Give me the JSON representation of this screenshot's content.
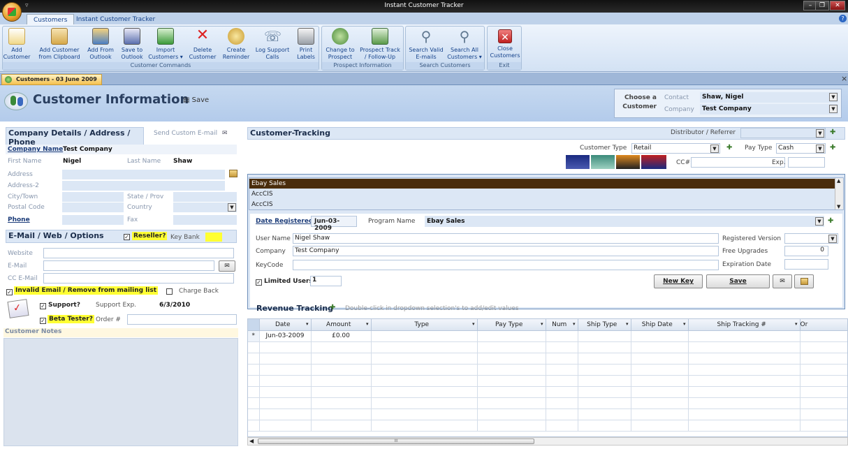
{
  "window": {
    "title": "Instant Customer Tracker",
    "help_glyph": "?"
  },
  "ribbon_tabs": [
    "Customers",
    "Instant Customer Tracker"
  ],
  "ribbon_groups": [
    {
      "label": "Customer Commands",
      "buttons": [
        {
          "line1": "Add",
          "line2": "Customer",
          "icon": "add-customer-icon"
        },
        {
          "line1": "Add Customer",
          "line2": "from Clipboard",
          "icon": "clipboard-icon"
        },
        {
          "line1": "Add From",
          "line2": "Outlook",
          "icon": "outlook-add-icon"
        },
        {
          "line1": "Save to",
          "line2": "Outlook",
          "icon": "outlook-save-icon"
        },
        {
          "line1": "Import",
          "line2": "Customers ▾",
          "icon": "import-icon"
        },
        {
          "line1": "Delete",
          "line2": "Customer",
          "icon": "delete-icon"
        },
        {
          "line1": "Create",
          "line2": "Reminder",
          "icon": "reminder-icon"
        },
        {
          "line1": "Log Support",
          "line2": "Calls",
          "icon": "phone-icon"
        },
        {
          "line1": "Print",
          "line2": "Labels",
          "icon": "printer-icon"
        }
      ]
    },
    {
      "label": "Prospect Information",
      "buttons": [
        {
          "line1": "Change to",
          "line2": "Prospect",
          "icon": "prospect-icon"
        },
        {
          "line1": "Prospect Track",
          "line2": "/ Follow-Up",
          "icon": "followup-icon"
        }
      ]
    },
    {
      "label": "Search Customers",
      "buttons": [
        {
          "line1": "Search Valid",
          "line2": "E-mails",
          "icon": "search-icon"
        },
        {
          "line1": "Search All",
          "line2": "Customers ▾",
          "icon": "search-all-icon"
        }
      ]
    },
    {
      "label": "Exit",
      "buttons": [
        {
          "line1": "Close",
          "line2": "Customers",
          "icon": "close-icon"
        }
      ]
    }
  ],
  "doc_tab": {
    "label": "Customers - 03 June 2009",
    "close": "×"
  },
  "header": {
    "title": "Customer Information",
    "save_label": "Save",
    "choose_label1": "Choose a",
    "choose_label2": "Customer",
    "contact_label": "Contact",
    "contact_value": "Shaw, Nigel",
    "company_label": "Company",
    "company_value": "Test Company"
  },
  "company_details": {
    "section_title": "Company Details / Address / Phone",
    "send_email": "Send Custom E-mail",
    "company_name_label": "Company Name",
    "company_name": "Test Company",
    "first_name_label": "First Name",
    "first_name": "Nigel",
    "last_name_label": "Last Name",
    "last_name": "Shaw",
    "address_label": "Address",
    "address2_label": "Address-2",
    "city_label": "City/Town",
    "state_label": "State / Prov",
    "postal_label": "Postal Code",
    "country_label": "Country",
    "phone_label": "Phone",
    "fax_label": "Fax"
  },
  "email_section": {
    "section_title": "E-Mail / Web / Options",
    "reseller_label": "Reseller?",
    "key_bank_label": "Key Bank",
    "website_label": "Website",
    "email_label": "E-Mail",
    "cc_email_label": "CC E-Mail",
    "invalid_email_label": "Invalid Email / Remove from mailing list",
    "charge_back_label": "Charge Back",
    "support_label": "Support?",
    "support_exp_label": "Support Exp.",
    "support_exp_value": "6/3/2010",
    "beta_label": "Beta Tester?",
    "order_label": "Order #",
    "notes_label": "Customer Notes"
  },
  "tracking": {
    "section_title": "Customer-Tracking",
    "distributor_label": "Distributor / Referrer",
    "customer_type_label": "Customer Type",
    "customer_type_value": "Retail",
    "pay_type_label": "Pay Type",
    "pay_type_value": "Cash",
    "cc_label": "CC#",
    "exp_label": "Exp.",
    "programs": [
      "Ebay Sales",
      "AccCIS",
      "AccCIS"
    ],
    "date_registered_label": "Date Registered",
    "date_registered_value": "Jun-03-2009",
    "program_name_label": "Program Name",
    "program_name_value": "Ebay Sales",
    "user_name_label": "User Name",
    "user_name_value": "Nigel Shaw",
    "company_label": "Company",
    "company_value": "Test Company",
    "keycode_label": "KeyCode",
    "registered_version_label": "Registered Version",
    "free_upgrades_label": "Free Upgrades",
    "free_upgrades_value": "0",
    "expiration_label": "Expiration Date",
    "limited_users_label": "Limited Users",
    "limited_users_value": "1",
    "new_key_label": "New Key",
    "save_label": "Save"
  },
  "revenue": {
    "title": "Revenue Tracking",
    "hint": "Double-click in dropdown selection's to add/edit values",
    "columns": [
      "Date",
      "Amount",
      "Type",
      "Pay Type",
      "Num",
      "Ship Type",
      "Ship Date",
      "Ship Tracking #",
      "Or"
    ],
    "new_row_marker": "*",
    "row": {
      "date": "Jun-03-2009",
      "amount": "£0.00"
    },
    "scroll_glyph": "III"
  },
  "colors": {
    "accent_yellow": "#ffff33",
    "selected_row": "#4a2d0c"
  }
}
